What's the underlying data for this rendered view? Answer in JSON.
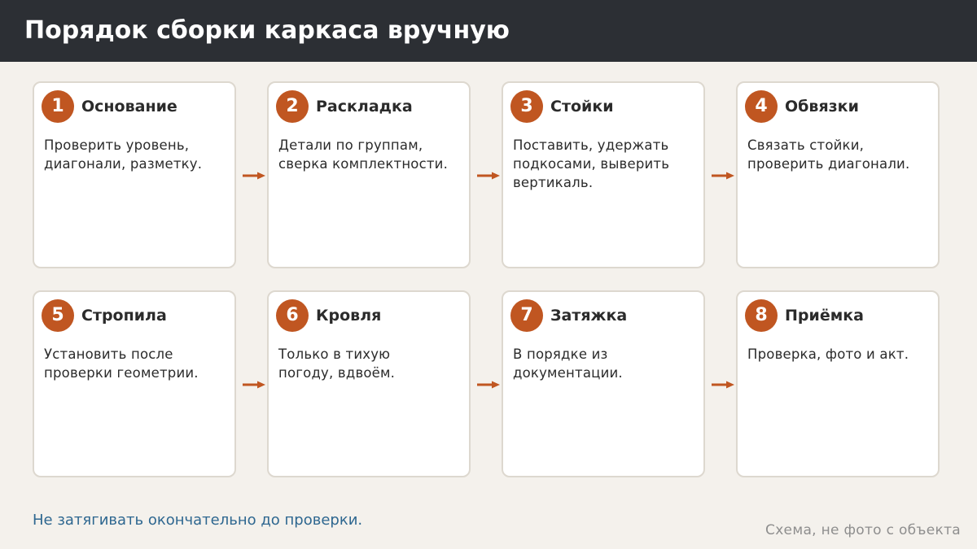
{
  "title": "Порядок сборки каркаса вручную",
  "steps": [
    {
      "number": "1",
      "title": "Основание",
      "text": "Проверить уровень, диагонали, разметку."
    },
    {
      "number": "2",
      "title": "Раскладка",
      "text": "Детали по группам, сверка комплектности."
    },
    {
      "number": "3",
      "title": "Стойки",
      "text": "Поставить, удержать подкосами, выверить вертикаль."
    },
    {
      "number": "4",
      "title": "Обвязки",
      "text": "Связать стойки, проверить диагонали."
    },
    {
      "number": "5",
      "title": "Стропила",
      "text": "Установить после проверки геометрии."
    },
    {
      "number": "6",
      "title": "Кровля",
      "text": "Только в тихую погоду, вдвоём."
    },
    {
      "number": "7",
      "title": "Затяжка",
      "text": "В порядке из документации."
    },
    {
      "number": "8",
      "title": "Приёмка",
      "text": "Проверка, фото и акт."
    }
  ],
  "footnote": "Не затягивать окончательно до проверки.",
  "caption": "Схема, не фото с объекта",
  "colors": {
    "header": "#2c2f34",
    "accent": "#c05621",
    "footnote": "#2e6790",
    "background": "#f4f1ec"
  }
}
